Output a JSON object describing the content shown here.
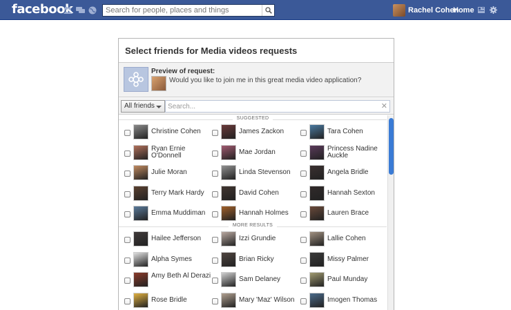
{
  "topbar": {
    "logo": "facebook",
    "search_placeholder": "Search for people, places and things",
    "profile_name": "Rachel Cohen",
    "home_label": "Home"
  },
  "dialog": {
    "title": "Select friends for Media videos requests",
    "preview_label": "Preview of request:",
    "preview_text": "Would you like to join me in this great media video application?",
    "filter_label": "All friends",
    "search_placeholder": "Search..."
  },
  "sections": {
    "suggested": "SUGGESTED",
    "more": "MORE RESULTS"
  },
  "suggested_friends": [
    {
      "name": "Christine Cohen",
      "color": "#8a8a8a"
    },
    {
      "name": "James Zackon",
      "color": "#6a3a3a"
    },
    {
      "name": "Tara Cohen",
      "color": "#4a7aa0"
    },
    {
      "name": "Ryan Ernie O'Donnell",
      "color": "#b0705a"
    },
    {
      "name": "Mae Jordan",
      "color": "#a05a70"
    },
    {
      "name": "Princess Nadine Auckle",
      "color": "#5a3a5a"
    },
    {
      "name": "Julie Moran",
      "color": "#c08a60"
    },
    {
      "name": "Linda Stevenson",
      "color": "#909090"
    },
    {
      "name": "Angela Bridle",
      "color": "#3a3030"
    },
    {
      "name": "Terry Mark Hardy",
      "color": "#5a4030"
    },
    {
      "name": "David Cohen",
      "color": "#403530"
    },
    {
      "name": "Hannah Sexton",
      "color": "#302a2a"
    },
    {
      "name": "Emma Muddiman",
      "color": "#5a7a9a"
    },
    {
      "name": "Hannah Holmes",
      "color": "#a0602a"
    },
    {
      "name": "Lauren Brace",
      "color": "#6a4a3a"
    }
  ],
  "more_friends": [
    {
      "name": "Hailee Jefferson",
      "color": "#403a3a"
    },
    {
      "name": "Izzi Grundie",
      "color": "#b8a8a0"
    },
    {
      "name": "Lallie Cohen",
      "color": "#a09080"
    },
    {
      "name": "Alpha Symes",
      "color": "#e0e0e0"
    },
    {
      "name": "Brian Ricky",
      "color": "#504540"
    },
    {
      "name": "Missy Palmer",
      "color": "#3a3a3a"
    },
    {
      "name": "Amy Beth Al Derazi",
      "color": "#8a3a2a"
    },
    {
      "name": "Sam Delaney",
      "color": "#d0d0d0"
    },
    {
      "name": "Paul Munday",
      "color": "#a09a70"
    },
    {
      "name": "Rose Bridle",
      "color": "#e0b040"
    },
    {
      "name": "Mary 'Maz' Wilson",
      "color": "#b0a090"
    },
    {
      "name": "Imogen Thomas",
      "color": "#4a6a8a"
    }
  ]
}
